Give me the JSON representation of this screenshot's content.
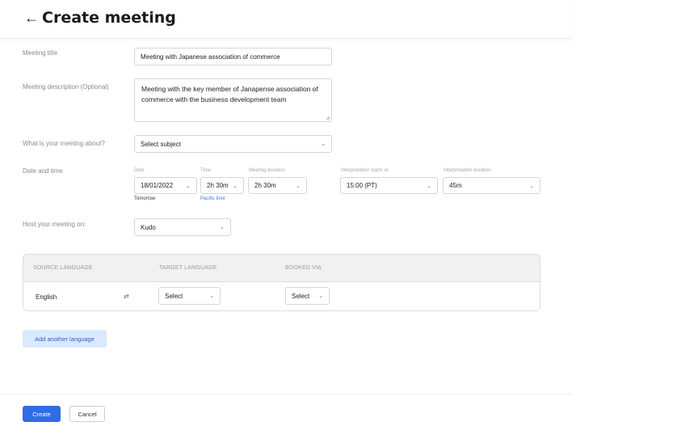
{
  "header": {
    "back_icon": "←",
    "title": "Create meeting"
  },
  "form": {
    "title_label": "Meeting title",
    "title_value": "Meeting with Japanese association of commerce",
    "description_label": "Meeting description (Optional)",
    "description_value": "Meeting with the key member of Janapense association of commerce with the business development team",
    "subject_label": "What is your meeting about?",
    "subject_value": "Select subject",
    "datetime_label": "Date and time",
    "date_label": "Date",
    "date_value": "18/01/2022",
    "date_hint": "Tomorrow",
    "time_label": "Time",
    "time_value": "2h 30m",
    "time_hint": "Pacific time",
    "duration_label": "Meeting duration",
    "duration_value": "2h 30m",
    "interp_start_label": "Interpretation starts at",
    "interp_start_value": "15:00 (PT)",
    "interp_duration_label": "Interpretation duration",
    "interp_duration_value": "45m",
    "host_label": "Host your meeting on:",
    "host_value": "Kudo"
  },
  "languages": {
    "headers": [
      "SOURCE LANGUAGE",
      "TARGET LANGUAGE",
      "BOOKED VIA"
    ],
    "source_value": "English",
    "swap_icon": "⇄",
    "target_value": "Select",
    "booked_value": "Select"
  },
  "add_language_label": "Add another language",
  "footer": {
    "create_label": "Create",
    "cancel_label": "Cancel"
  },
  "icons": {
    "chevron": "⌄"
  },
  "colors": {
    "primary": "#2f6ce5",
    "secondary_bg": "#d9e9ff",
    "link": "#3b7ddd"
  }
}
